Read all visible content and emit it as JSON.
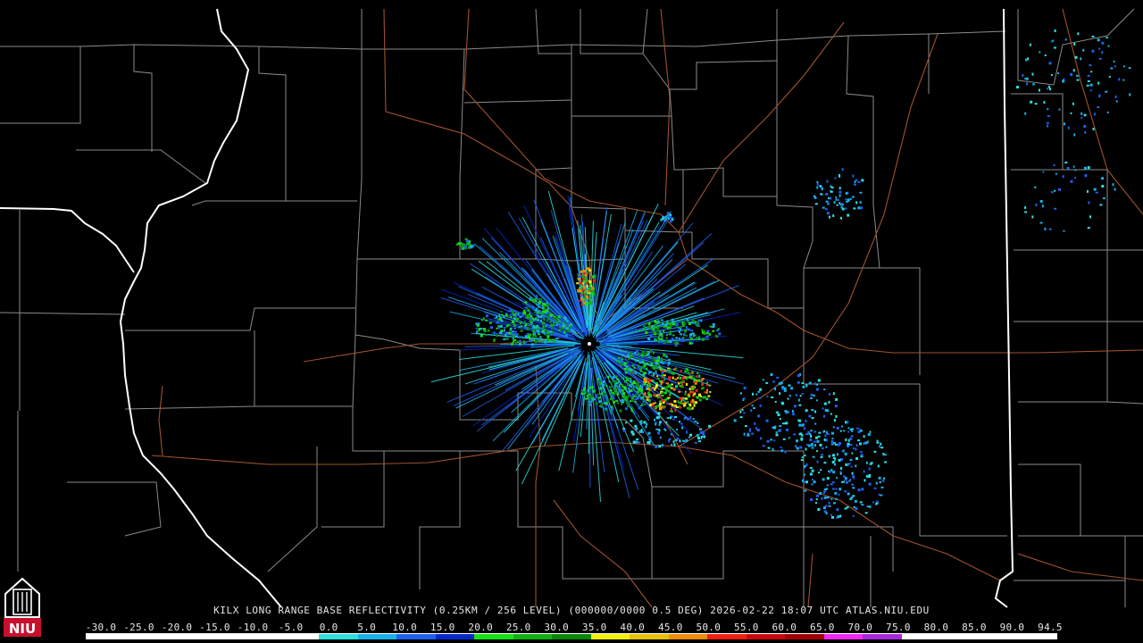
{
  "product": {
    "station": "KILX",
    "title": "LONG RANGE BASE REFLECTIVITY",
    "resolution": "(0.25KM / 256 LEVEL)",
    "volume": "(000000/0000 0.5 DEG)",
    "date": "2026-02-22",
    "time": "18:07 UTC",
    "credit": "ATLAS.NIU.EDU"
  },
  "logo": {
    "text": "NIU",
    "color": "#c8102e"
  },
  "scale": {
    "labels": [
      "-30.0",
      "-25.0",
      "-20.0",
      "-15.0",
      "-10.0",
      "-5.0",
      "0.0",
      "5.0",
      "10.0",
      "15.0",
      "20.0",
      "25.0",
      "30.0",
      "35.0",
      "40.0",
      "45.0",
      "50.0",
      "55.0",
      "60.0",
      "65.0",
      "70.0",
      "75.0",
      "80.0",
      "85.0",
      "90.0",
      "94.5"
    ],
    "colors": [
      "#ffffff",
      "#ffffff",
      "#ffffff",
      "#ffffff",
      "#ffffff",
      "#ffffff",
      "#2de0e0",
      "#18b0e8",
      "#1e60f0",
      "#0028c8",
      "#18e018",
      "#10b010",
      "#088808",
      "#f0f010",
      "#e8c008",
      "#f08c08",
      "#f02010",
      "#c80808",
      "#a00000",
      "#f028f0",
      "#a828d8",
      "#ffffff",
      "#ffffff",
      "#ffffff",
      "#ffffff"
    ]
  },
  "map": {
    "state_border_color": "#ffffff",
    "county_line_color": "#8a8a8a",
    "road_color": "#a0522d"
  }
}
